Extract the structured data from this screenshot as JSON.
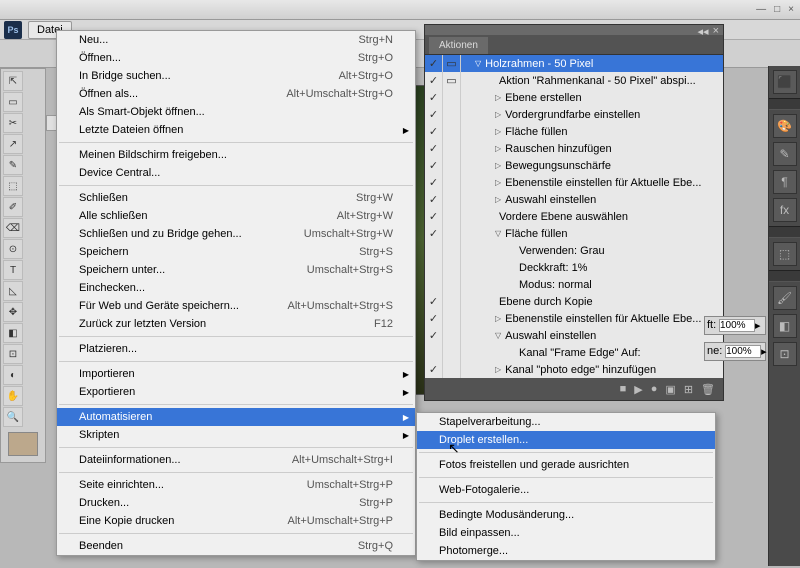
{
  "window": {
    "minimize": "—",
    "maximize": "□",
    "close": "×"
  },
  "ps": "Ps",
  "menubar": {
    "file": "Datei"
  },
  "tools": [
    "⇱",
    "▭",
    "✂",
    "↗",
    "✎",
    "⬚",
    "✐",
    "⌫",
    "⊙",
    "T",
    "◺",
    "✥",
    "◧",
    "⊡",
    "◐",
    "✋",
    "🔍"
  ],
  "fileMenu": [
    {
      "t": "item",
      "l": "Neu...",
      "s": "Strg+N"
    },
    {
      "t": "item",
      "l": "Öffnen...",
      "s": "Strg+O"
    },
    {
      "t": "item",
      "l": "In Bridge suchen...",
      "s": "Alt+Strg+O"
    },
    {
      "t": "item",
      "l": "Öffnen als...",
      "s": "Alt+Umschalt+Strg+O"
    },
    {
      "t": "item",
      "l": "Als Smart-Objekt öffnen..."
    },
    {
      "t": "item",
      "l": "Letzte Dateien öffnen",
      "arrow": true
    },
    {
      "t": "sep"
    },
    {
      "t": "item",
      "l": "Meinen Bildschirm freigeben..."
    },
    {
      "t": "item",
      "l": "Device Central..."
    },
    {
      "t": "sep"
    },
    {
      "t": "item",
      "l": "Schließen",
      "s": "Strg+W"
    },
    {
      "t": "item",
      "l": "Alle schließen",
      "s": "Alt+Strg+W"
    },
    {
      "t": "item",
      "l": "Schließen und zu Bridge gehen...",
      "s": "Umschalt+Strg+W"
    },
    {
      "t": "item",
      "l": "Speichern",
      "s": "Strg+S"
    },
    {
      "t": "item",
      "l": "Speichern unter...",
      "s": "Umschalt+Strg+S"
    },
    {
      "t": "item",
      "l": "Einchecken..."
    },
    {
      "t": "item",
      "l": "Für Web und Geräte speichern...",
      "s": "Alt+Umschalt+Strg+S"
    },
    {
      "t": "item",
      "l": "Zurück zur letzten Version",
      "s": "F12"
    },
    {
      "t": "sep"
    },
    {
      "t": "item",
      "l": "Platzieren..."
    },
    {
      "t": "sep"
    },
    {
      "t": "item",
      "l": "Importieren",
      "arrow": true
    },
    {
      "t": "item",
      "l": "Exportieren",
      "arrow": true
    },
    {
      "t": "sep"
    },
    {
      "t": "item",
      "l": "Automatisieren",
      "arrow": true,
      "hl": true
    },
    {
      "t": "item",
      "l": "Skripten",
      "arrow": true
    },
    {
      "t": "sep"
    },
    {
      "t": "item",
      "l": "Dateiinformationen...",
      "s": "Alt+Umschalt+Strg+I"
    },
    {
      "t": "sep"
    },
    {
      "t": "item",
      "l": "Seite einrichten...",
      "s": "Umschalt+Strg+P"
    },
    {
      "t": "item",
      "l": "Drucken...",
      "s": "Strg+P"
    },
    {
      "t": "item",
      "l": "Eine Kopie drucken",
      "s": "Alt+Umschalt+Strg+P"
    },
    {
      "t": "sep"
    },
    {
      "t": "item",
      "l": "Beenden",
      "s": "Strg+Q"
    }
  ],
  "subMenu": [
    {
      "t": "item",
      "l": "Stapelverarbeitung..."
    },
    {
      "t": "item",
      "l": "Droplet erstellen...",
      "hl": true
    },
    {
      "t": "sep"
    },
    {
      "t": "item",
      "l": "Fotos freistellen und gerade ausrichten"
    },
    {
      "t": "sep"
    },
    {
      "t": "item",
      "l": "Web-Fotogalerie..."
    },
    {
      "t": "sep"
    },
    {
      "t": "item",
      "l": "Bedingte Modusänderung..."
    },
    {
      "t": "item",
      "l": "Bild einpassen..."
    },
    {
      "t": "item",
      "l": "Photomerge..."
    }
  ],
  "actions": {
    "tab": "Aktionen",
    "footIcons": [
      "■",
      "▶",
      "●",
      "▣",
      "⊞",
      "🗑"
    ],
    "rows": [
      {
        "c1": "✓",
        "c2": "▭",
        "ind": 14,
        "tri": "▽",
        "txt": "Holzrahmen - 50 Pixel",
        "hl": true
      },
      {
        "c1": "✓",
        "c2": "▭",
        "ind": 34,
        "tri": "",
        "txt": "Aktion \"Rahmenkanal - 50 Pixel\" abspi..."
      },
      {
        "c1": "✓",
        "c2": "",
        "ind": 34,
        "tri": "▷",
        "txt": "Ebene erstellen"
      },
      {
        "c1": "✓",
        "c2": "",
        "ind": 34,
        "tri": "▷",
        "txt": "Vordergrundfarbe einstellen"
      },
      {
        "c1": "✓",
        "c2": "",
        "ind": 34,
        "tri": "▷",
        "txt": "Fläche füllen"
      },
      {
        "c1": "✓",
        "c2": "",
        "ind": 34,
        "tri": "▷",
        "txt": "Rauschen hinzufügen"
      },
      {
        "c1": "✓",
        "c2": "",
        "ind": 34,
        "tri": "▷",
        "txt": "Bewegungsunschärfe"
      },
      {
        "c1": "✓",
        "c2": "",
        "ind": 34,
        "tri": "▷",
        "txt": "Ebenenstile einstellen  für Aktuelle Ebe..."
      },
      {
        "c1": "✓",
        "c2": "",
        "ind": 34,
        "tri": "▷",
        "txt": "Auswahl einstellen"
      },
      {
        "c1": "✓",
        "c2": "",
        "ind": 34,
        "tri": "",
        "txt": "Vordere Ebene auswählen"
      },
      {
        "c1": "✓",
        "c2": "",
        "ind": 34,
        "tri": "▽",
        "txt": "Fläche füllen"
      },
      {
        "c1": "",
        "c2": "",
        "ind": 54,
        "tri": "",
        "txt": "Verwenden: Grau"
      },
      {
        "c1": "",
        "c2": "",
        "ind": 54,
        "tri": "",
        "txt": "Deckkraft: 1%"
      },
      {
        "c1": "",
        "c2": "",
        "ind": 54,
        "tri": "",
        "txt": "Modus: normal"
      },
      {
        "c1": "✓",
        "c2": "",
        "ind": 34,
        "tri": "",
        "txt": "Ebene durch Kopie"
      },
      {
        "c1": "✓",
        "c2": "",
        "ind": 34,
        "tri": "▷",
        "txt": "Ebenenstile einstellen  für Aktuelle Ebe..."
      },
      {
        "c1": "✓",
        "c2": "",
        "ind": 34,
        "tri": "▽",
        "txt": "Auswahl einstellen"
      },
      {
        "c1": "",
        "c2": "",
        "ind": 54,
        "tri": "",
        "txt": "Kanal \"Frame Edge\" Auf:"
      },
      {
        "c1": "✓",
        "c2": "",
        "ind": 34,
        "tri": "▷",
        "txt": "Kanal \"photo edge\" hinzufügen"
      }
    ]
  },
  "rp": {
    "icons": [
      "⬛",
      "🎨",
      "✎",
      "¶",
      "fx",
      "⬚",
      "🖌",
      "◧",
      "⊡"
    ],
    "ft": "ft:",
    "ne": "ne:",
    "pct": "100%",
    "fx": "fx"
  }
}
